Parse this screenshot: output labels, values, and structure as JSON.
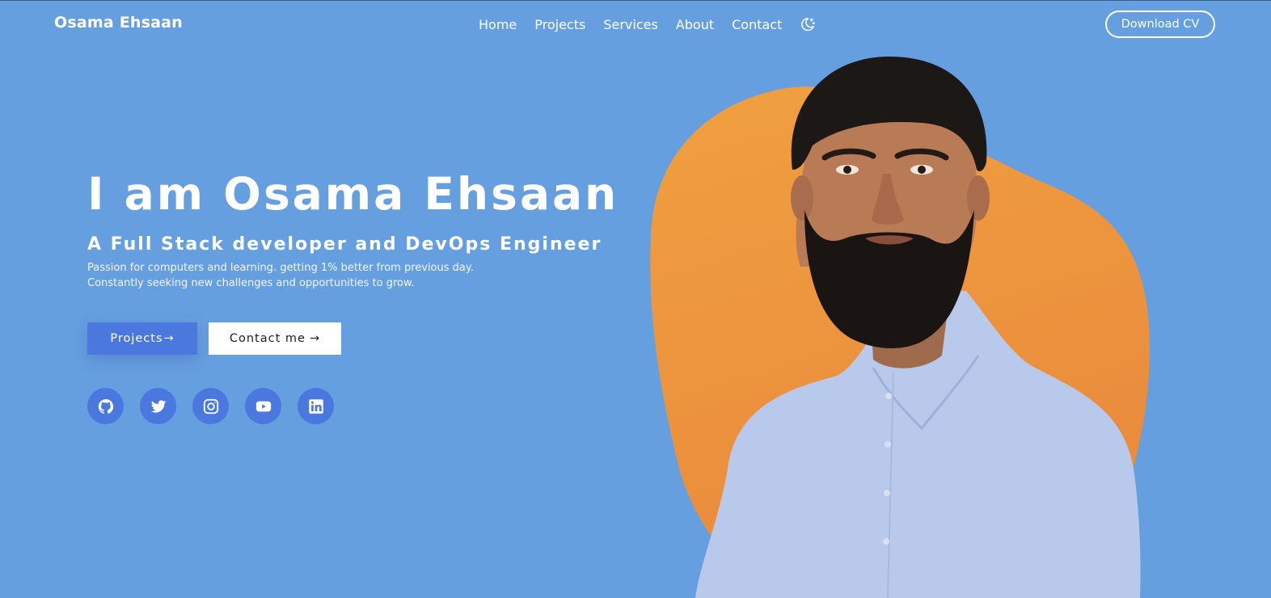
{
  "header": {
    "brand": "Osama Ehsaan",
    "nav": [
      {
        "label": "Home"
      },
      {
        "label": "Projects"
      },
      {
        "label": "Services"
      },
      {
        "label": "About"
      },
      {
        "label": "Contact"
      }
    ],
    "theme_toggle_icon": "moon-stars-icon",
    "download_cv_label": "Download CV"
  },
  "hero": {
    "title": "I am Osama Ehsaan",
    "subtitle": "A Full Stack developer and DevOps Engineer",
    "description": [
      "Passion for computers and learning. getting 1% better from previous day.",
      "Constantly seeking new challenges and opportunities to grow."
    ],
    "projects_button": "Projects",
    "contact_button": "Contact me",
    "arrow_glyph": "→"
  },
  "socials": [
    {
      "name": "github",
      "icon": "github-icon"
    },
    {
      "name": "twitter",
      "icon": "twitter-icon"
    },
    {
      "name": "instagram",
      "icon": "instagram-icon"
    },
    {
      "name": "youtube",
      "icon": "youtube-icon"
    },
    {
      "name": "linkedin",
      "icon": "linkedin-icon"
    }
  ],
  "colors": {
    "background": "#669fe0",
    "accent_blue": "#4b78df",
    "blob_orange": "#ec9a3e",
    "text": "#ffffff"
  }
}
